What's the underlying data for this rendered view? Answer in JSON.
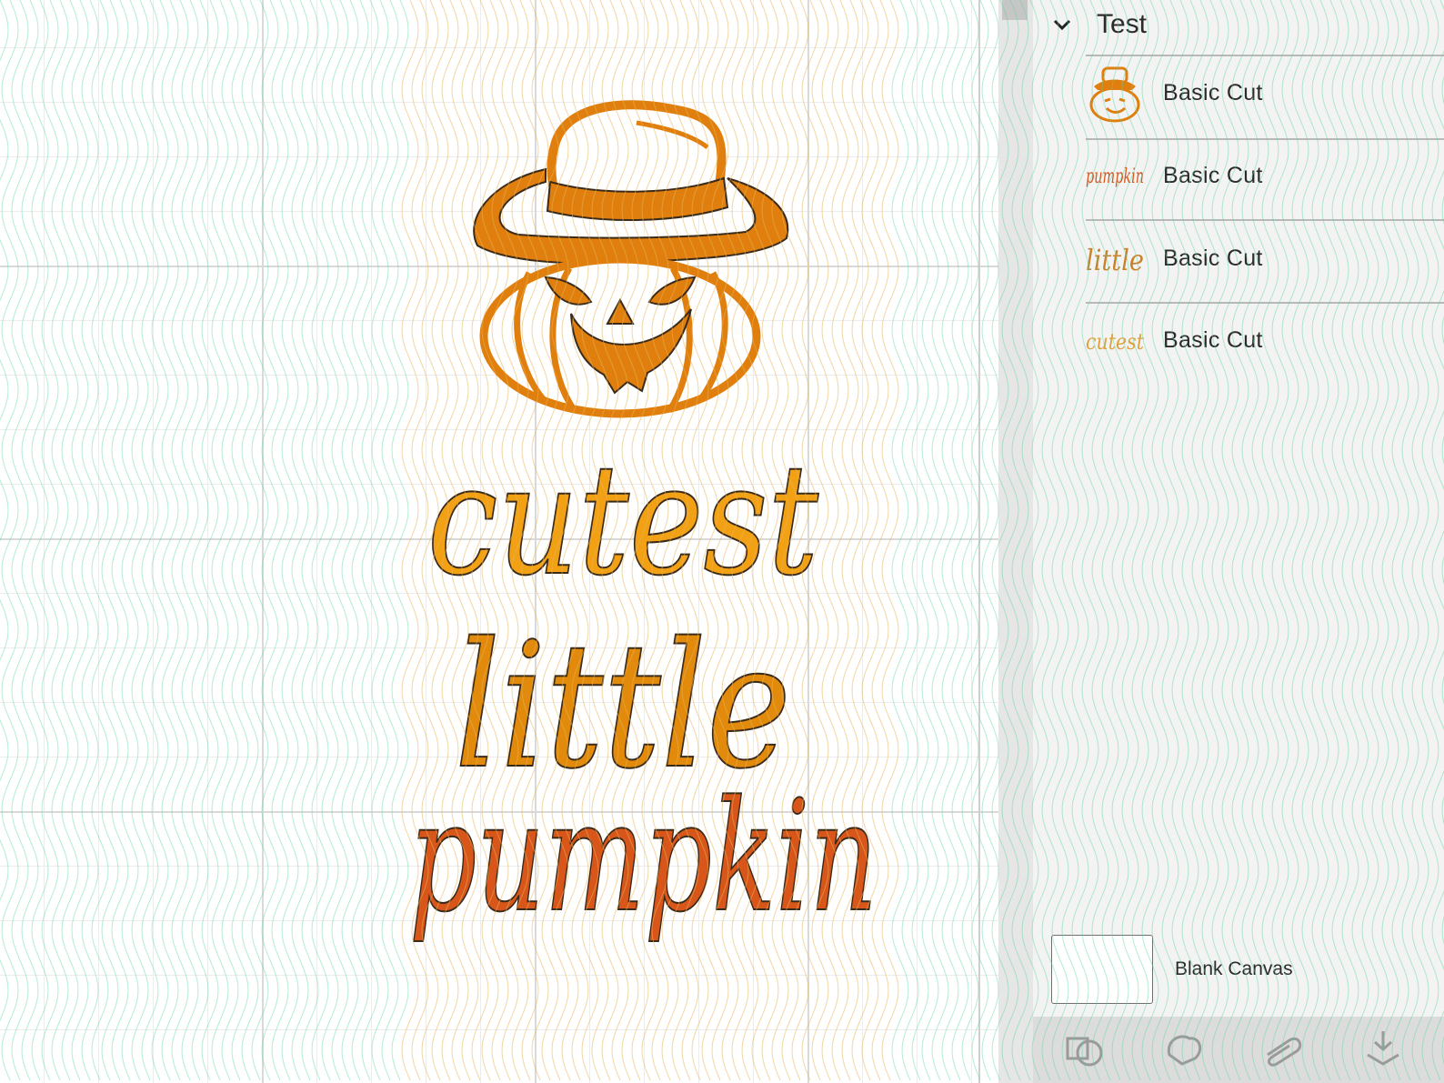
{
  "layers_panel": {
    "group": {
      "name": "Test",
      "expanded": true
    },
    "layers": [
      {
        "label": "Basic Cut",
        "thumbnail": "pumpkin-with-hat"
      },
      {
        "label": "Basic Cut",
        "thumbnail": "pumpkin-word"
      },
      {
        "label": "Basic Cut",
        "thumbnail": "little-word"
      },
      {
        "label": "Basic Cut",
        "thumbnail": "cutest-word"
      }
    ],
    "blank_canvas": {
      "label": "Blank Canvas"
    }
  },
  "design": {
    "words": [
      "cutest",
      "little",
      "pumpkin"
    ],
    "colors": {
      "cutest": "#f2a115",
      "little": "#e28a0b",
      "pumpkin": "#d8561a",
      "pumpkin_art": "#e07f0d",
      "outline": "#3a2a1a"
    }
  },
  "toolbar": {
    "buttons": [
      "slice-icon",
      "weld-icon",
      "attach-icon",
      "flatten-icon"
    ]
  }
}
